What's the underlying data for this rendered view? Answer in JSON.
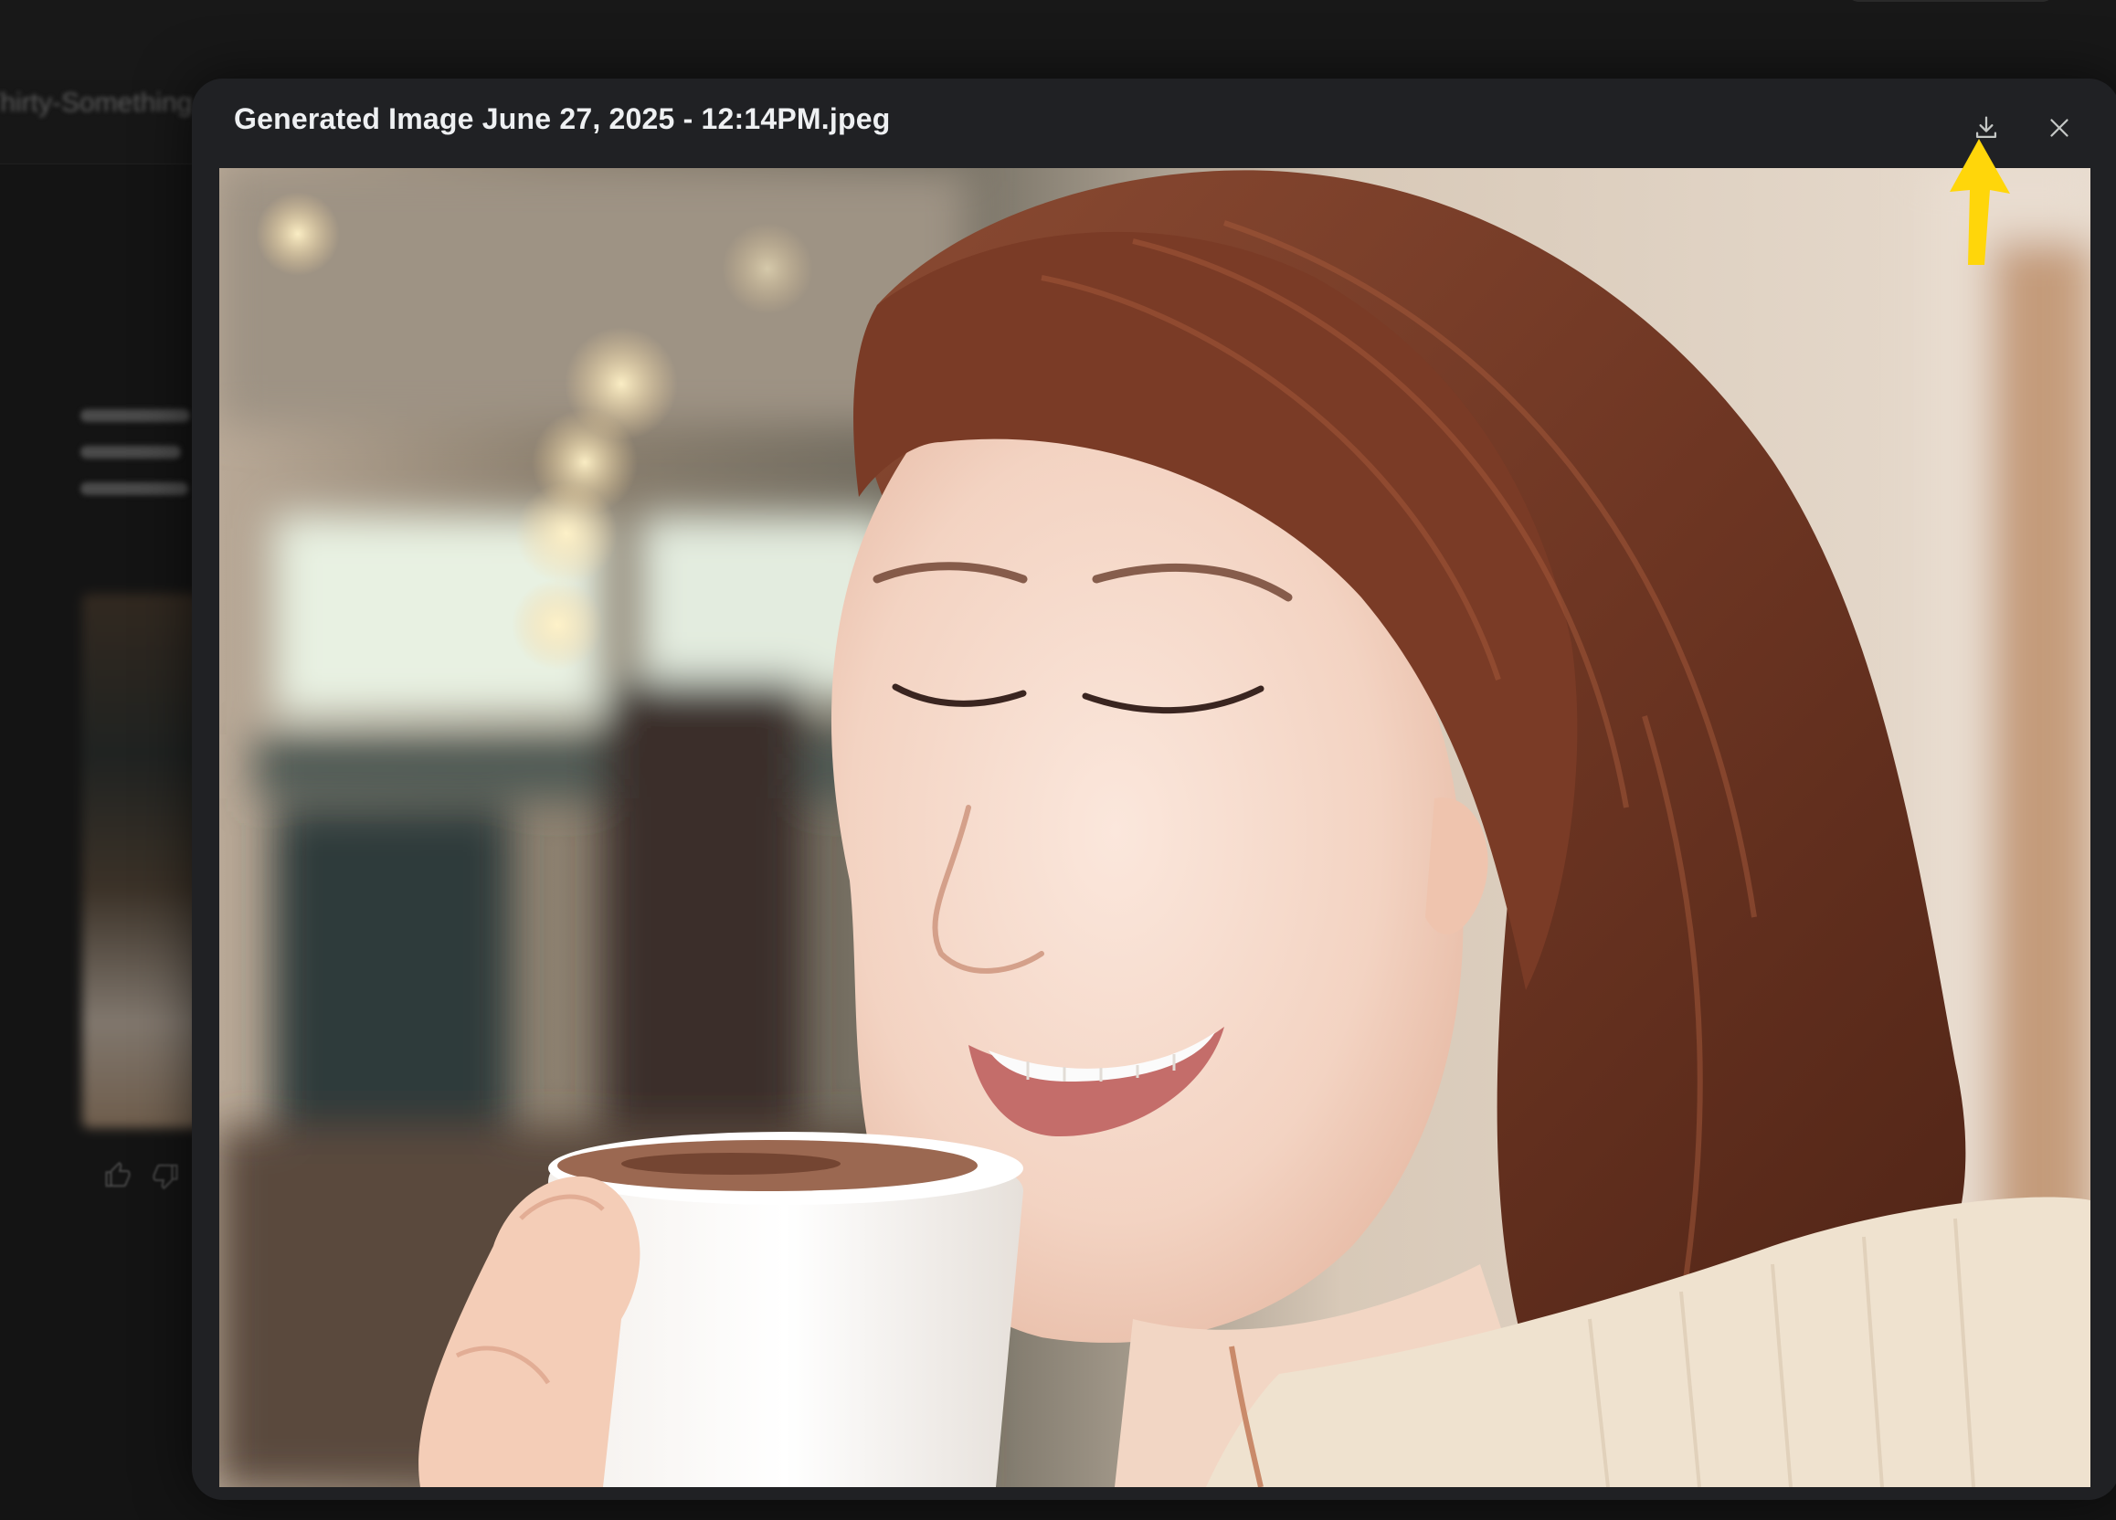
{
  "background": {
    "chat_title": "Thirty-Something"
  },
  "modal": {
    "title": "Generated Image June 27, 2025 - 12:14PM.jpeg",
    "download_label": "Download",
    "close_label": "Close",
    "icons": {
      "download": "download-icon",
      "close": "close-icon",
      "thumbs_up": "thumbs-up-icon",
      "thumbs_down": "thumbs-down-icon"
    },
    "image": {
      "alt": "A smiling woman with auburn bob hair sipping from a white ceramic cup in a cafe"
    }
  },
  "colors": {
    "modal_bg": "#202124",
    "page_bg": "#141414",
    "annotation_arrow": "#ffd60a"
  }
}
